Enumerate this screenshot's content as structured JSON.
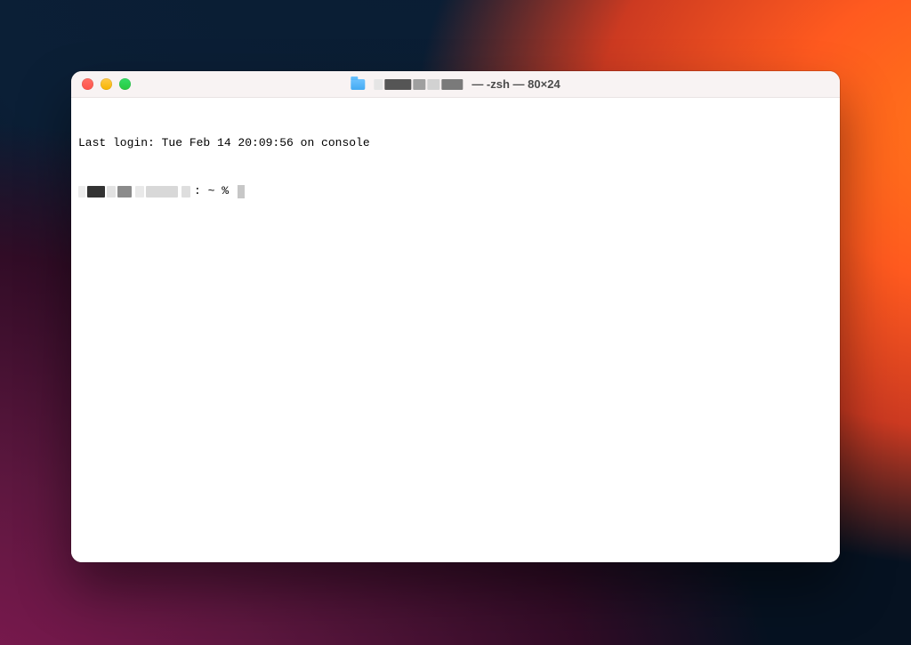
{
  "window": {
    "title_suffix": "— -zsh — 80×24"
  },
  "terminal": {
    "last_login": "Last login: Tue Feb 14 20:09:56 on console",
    "prompt_suffix": ": ~ % "
  }
}
